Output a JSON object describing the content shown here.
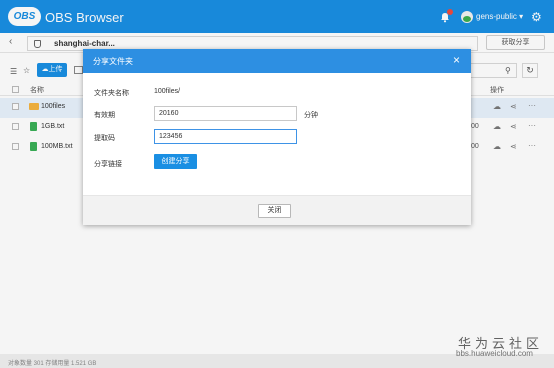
{
  "app": {
    "logo_text": "OBS",
    "title": "OBS Browser",
    "user": "gens-public ▾",
    "accent_color": "#1a8fe3"
  },
  "address": {
    "path": "shanghai-char...",
    "share_button": "获取分享"
  },
  "toolbar": {
    "upload_label": "上传"
  },
  "table": {
    "col_name": "名称",
    "col_ops": "操作",
    "rows": [
      {
        "name": "100files",
        "type": "folder",
        "tail": ""
      },
      {
        "name": "1GB.txt",
        "type": "file",
        "tail": "00"
      },
      {
        "name": "100MB.txt",
        "type": "file",
        "tail": "00"
      }
    ]
  },
  "status": {
    "text": "对象数量 301    存储用量 1.521 GB"
  },
  "watermark": {
    "line1": "华为云社区",
    "line2": "bbs.huaweicloud.com"
  },
  "dialog": {
    "title": "分享文件夹",
    "folder_label": "文件夹名称",
    "folder_value": "100files/",
    "validity_label": "有效期",
    "validity_value": "20160",
    "validity_unit": "分钟",
    "code_label": "提取码",
    "code_value": "123456",
    "link_label": "分享链接",
    "create_button": "创建分享",
    "close_button": "关闭"
  }
}
